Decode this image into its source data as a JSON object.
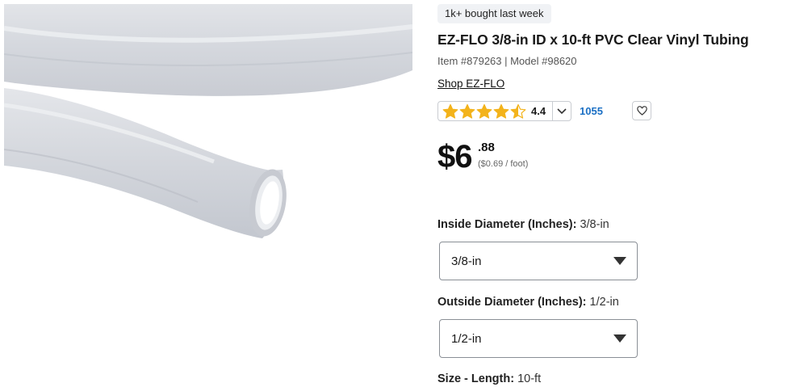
{
  "product": {
    "badge": "1k+ bought last week",
    "title": "EZ-FLO 3/8-in ID x 10-ft PVC Clear Vinyl Tubing",
    "meta": "Item #879263 | Model #98620",
    "shop_link": "Shop EZ-FLO",
    "image_alt": "clear-vinyl-tubing-photo"
  },
  "rating": {
    "value": "4.4",
    "stars": 4.5,
    "review_count": "1055",
    "star_color": "#f3b31b"
  },
  "price": {
    "dollars": "$6",
    "cents": ".88",
    "unit_price": "($0.69 / foot)"
  },
  "options": {
    "inside": {
      "label": "Inside Diameter (Inches):",
      "value": "3/8-in",
      "selected": "3/8-in"
    },
    "outside": {
      "label": "Outside Diameter (Inches):",
      "value": "1/2-in",
      "selected": "1/2-in"
    },
    "size": {
      "label": "Size - Length:",
      "value": "10-ft"
    }
  },
  "icons": {
    "rating_caret": "chevron-down-icon",
    "favorite": "heart-icon",
    "select_caret": "triangle-down-icon"
  },
  "colors": {
    "link_blue": "#1a6fc4",
    "badge_bg": "#f0f2f5"
  }
}
